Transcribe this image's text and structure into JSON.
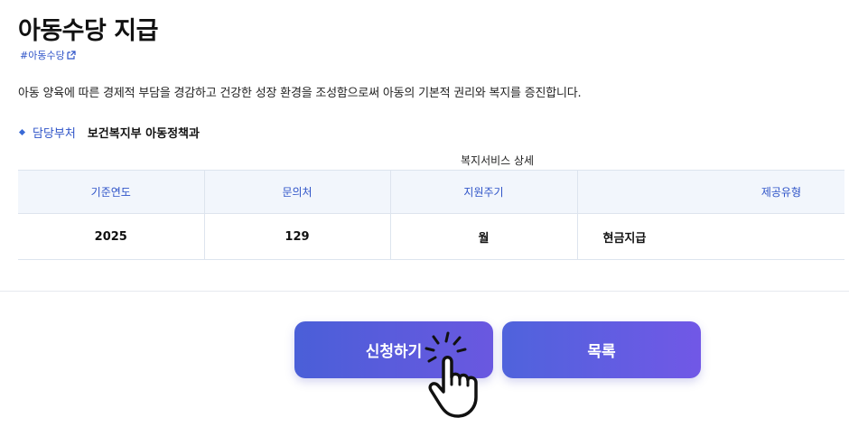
{
  "page": {
    "title": "아동수당 지급",
    "hashtag": "#아동수당",
    "description": "아동 양육에 따른 경제적 부담을 경감하고 건강한 성장 환경을 조성함으로써 아동의 기본적 권리와 복지를 증진합니다."
  },
  "department": {
    "label": "담당부처",
    "value": "보건복지부 아동정책과"
  },
  "service_table": {
    "caption": "복지서비스 상세",
    "headers": [
      "기준연도",
      "문의처",
      "지원주기",
      "제공유형"
    ],
    "rows": [
      [
        "2025",
        "129",
        "월",
        "현금지급"
      ]
    ]
  },
  "buttons": {
    "apply": "신청하기",
    "list": "목록"
  },
  "colors": {
    "accent": "#2f54c8",
    "button_gradient_start": "#4a5fd8",
    "button_gradient_end": "#7158e6"
  },
  "icons": [
    "external-link-icon",
    "diamond-bullet-icon",
    "hand-pointer-icon"
  ]
}
